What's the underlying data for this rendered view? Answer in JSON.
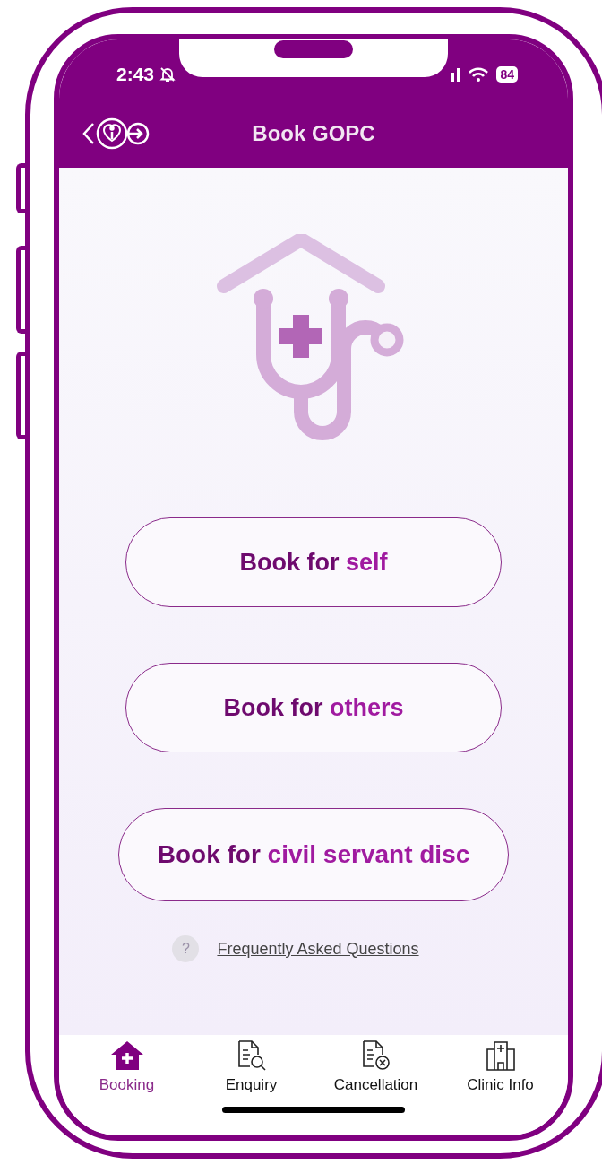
{
  "status_bar": {
    "time": "2:43",
    "battery": "84"
  },
  "header": {
    "title": "Book GOPC"
  },
  "options": [
    {
      "lead": "Book for",
      "highlight": "self"
    },
    {
      "lead": "Book for",
      "highlight": "others"
    },
    {
      "lead": "Book for",
      "highlight": "civil servant disc"
    }
  ],
  "faq": {
    "badge": "?",
    "link": "Frequently Asked Questions"
  },
  "tabs": [
    {
      "kind": "booking",
      "label": "Booking",
      "selected": true
    },
    {
      "kind": "enquiry",
      "label": "Enquiry",
      "selected": false
    },
    {
      "kind": "cancellation",
      "label": "Cancellation",
      "selected": false
    },
    {
      "kind": "clinic",
      "label": "Clinic Info",
      "selected": false
    }
  ]
}
